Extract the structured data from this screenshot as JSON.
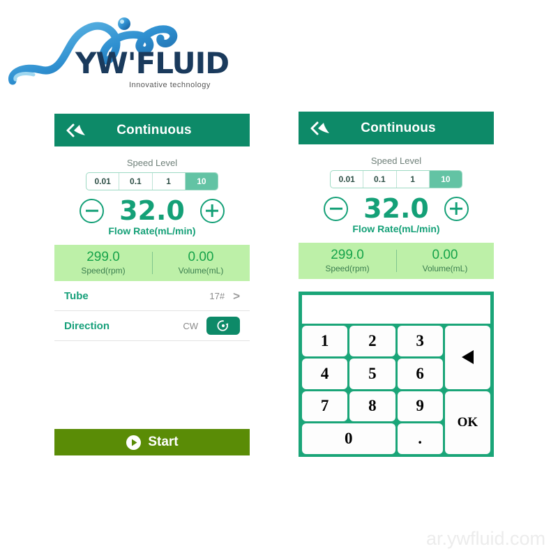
{
  "logo": {
    "wordmark": "YW'FLUID",
    "tagline": "Innovative technology",
    "brand_color": "#1a3a5c",
    "wave_color": "#2e8fd0"
  },
  "watermark": "ar.ywfluid.com",
  "theme": {
    "header_green": "#0d8a68",
    "accent_green": "#14a077",
    "stats_bg": "#bdf0a8",
    "start_green": "#5a8c06",
    "segment_active": "#63c3a4",
    "keypad_green": "#1aa578"
  },
  "panel_left": {
    "header": {
      "title": "Continuous",
      "back_icon": "double-chevron-back-icon"
    },
    "speed_level": {
      "label": "Speed Level",
      "options": [
        "0.01",
        "0.1",
        "1",
        "10"
      ],
      "selected": "10"
    },
    "flow": {
      "decrement_icon": "minus-circle-icon",
      "increment_icon": "plus-circle-icon",
      "value": "32.0",
      "unit_label": "Flow Rate(mL/min)"
    },
    "stats": [
      {
        "value": "299.0",
        "label": "Speed(rpm)"
      },
      {
        "value": "0.00",
        "label": "Volume(mL)"
      }
    ],
    "rows": [
      {
        "label": "Tube",
        "value": "17#",
        "chevron": ">"
      },
      {
        "label": "Direction",
        "value": "CW",
        "toggle_icon": "rotate-clockwise-icon"
      }
    ],
    "start_button": {
      "label": "Start",
      "icon": "play-circle-icon"
    }
  },
  "panel_right": {
    "header": {
      "title": "Continuous",
      "back_icon": "double-chevron-back-icon"
    },
    "speed_level": {
      "label": "Speed Level",
      "options": [
        "0.01",
        "0.1",
        "1",
        "10"
      ],
      "selected": "10"
    },
    "flow": {
      "decrement_icon": "minus-circle-icon",
      "increment_icon": "plus-circle-icon",
      "value": "32.0",
      "unit_label": "Flow Rate(mL/min)"
    },
    "stats": [
      {
        "value": "299.0",
        "label": "Speed(rpm)"
      },
      {
        "value": "0.00",
        "label": "Volume(mL)"
      }
    ],
    "keypad": {
      "display_value": "",
      "keys": [
        "1",
        "2",
        "3",
        "4",
        "5",
        "6",
        "7",
        "8",
        "9",
        "0",
        "."
      ],
      "backspace_icon": "backspace-arrow-icon",
      "ok_label": "OK"
    }
  }
}
